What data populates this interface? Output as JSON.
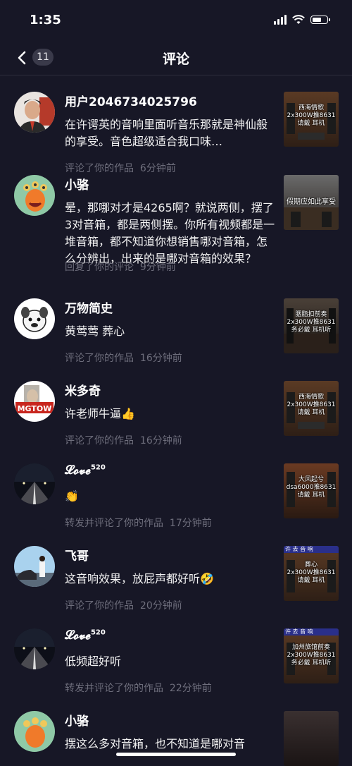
{
  "status": {
    "time": "1:35"
  },
  "nav": {
    "title": "评论",
    "badge": "11"
  },
  "comments": [
    {
      "name": "用户2046734025796",
      "text": "在许谔英的音响里面听音乐那就是神仙般的享受。音色超级适合我口味…",
      "action": "评论了你的作品",
      "time": "6分钟前",
      "thumb": {
        "caption": "西海情歌\n2x300W推8631\n请戴  耳机",
        "banner": ""
      }
    },
    {
      "name": "小骆",
      "text": "晕，那哪对才是4265啊？就说两侧，摆了3对音箱，都是两侧摆。你所有视频都是一堆音箱，都不知道你想销售哪对音箱，怎么分辨出，出来的是哪对音箱的效果？",
      "action": "回复了你的评论",
      "time": "9分钟前",
      "thumb": {
        "caption": "假期应如此享受",
        "banner": ""
      }
    },
    {
      "name": "万物简史",
      "text": "黄莺莺 葬心",
      "action": "评论了你的作品",
      "time": "16分钟前",
      "thumb": {
        "caption": "胭脂扣前奏\n2x300W推8631\n务必戴  耳机听",
        "banner": ""
      }
    },
    {
      "name": "米多奇",
      "text": "许老师牛逼👍",
      "action": "评论了你的作品",
      "time": "16分钟前",
      "thumb": {
        "caption": "西海情歌\n2x300W推8631\n请戴  耳机",
        "banner": ""
      }
    },
    {
      "name": "𝓛𝓸𝓿𝓮",
      "sup": "520",
      "text": "👏",
      "action": "转发并评论了你的作品",
      "time": "17分钟前",
      "thumb": {
        "caption": "大风起兮\ndsa6000推8631\n请戴  耳机",
        "banner": ""
      }
    },
    {
      "name": "飞哥",
      "text": "这音响效果，放屁声都好听🤣",
      "action": "评论了你的作品",
      "time": "20分钟前",
      "thumb": {
        "caption": "葬心\n2x300W推8631\n请戴  耳机",
        "banner": "许 去 音 响"
      }
    },
    {
      "name": "𝓛𝓸𝓿𝓮",
      "sup": "520",
      "text": "低频超好听",
      "action": "转发并评论了你的作品",
      "time": "22分钟前",
      "thumb": {
        "caption": "加州旅馆前奏\n2x300W推8631\n务必戴  耳机听",
        "banner": "许 去 音 响"
      }
    },
    {
      "name": "小骆",
      "text": "摆这么多对音箱，也不知道是哪对音",
      "action": "",
      "time": "",
      "thumb": {
        "caption": "",
        "banner": ""
      }
    }
  ]
}
